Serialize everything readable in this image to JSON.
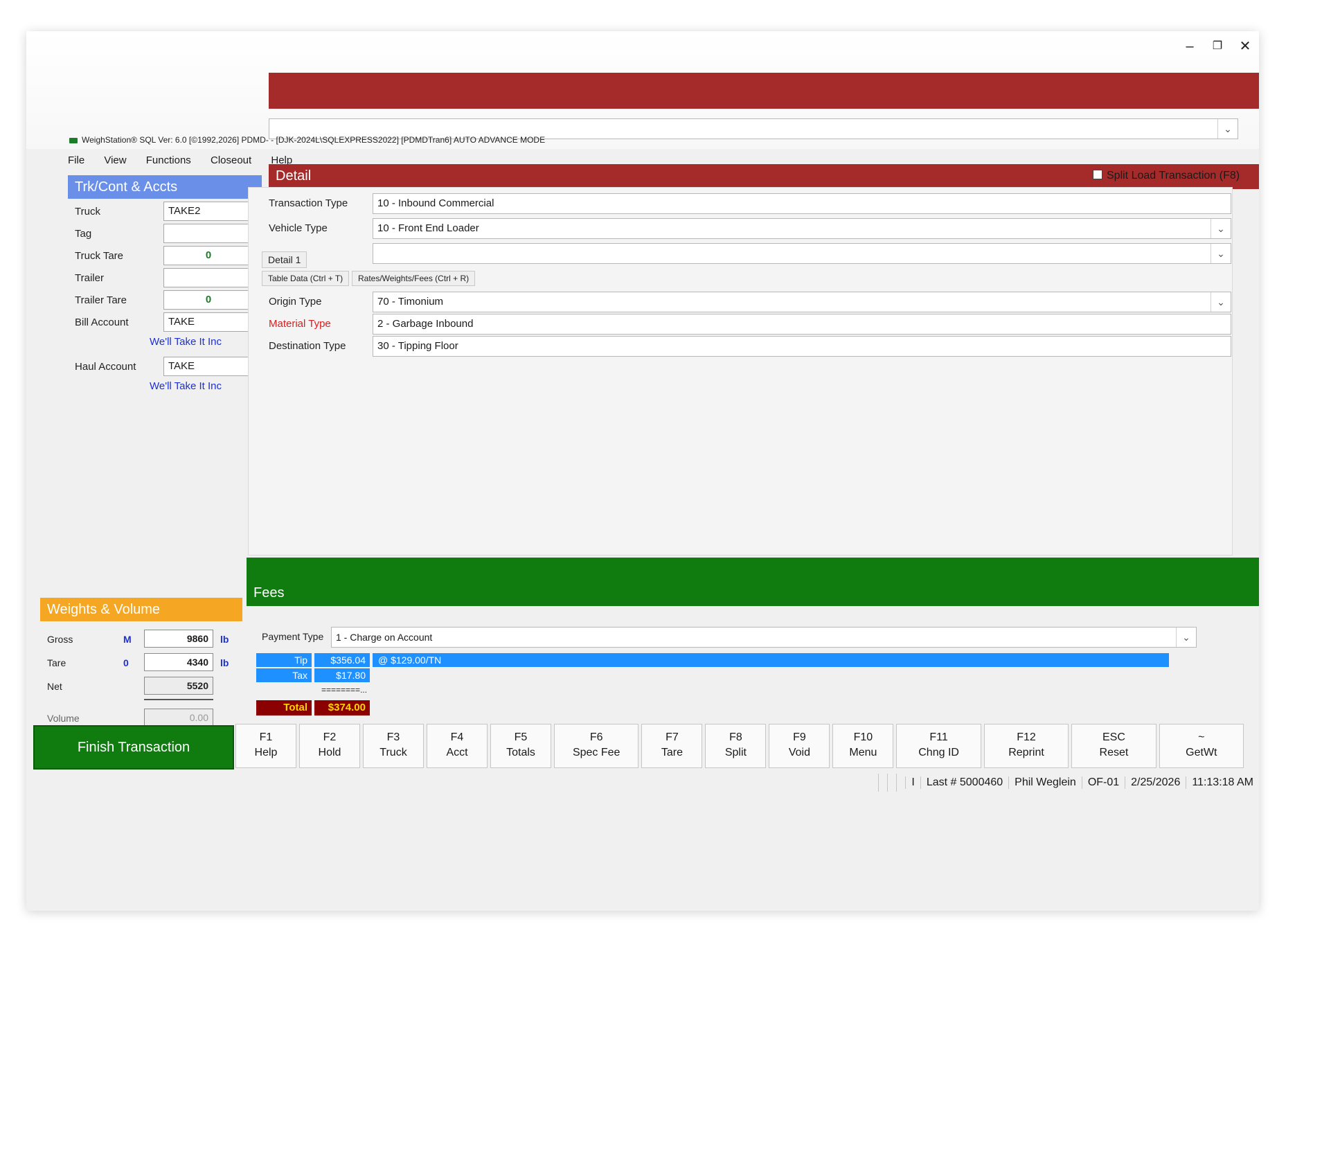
{
  "window": {
    "title": "WeighStation® SQL Ver: 6.0 [©1992,2026] PDMD- - [DJK-2024L\\SQLEXPRESS2022] [PDMDTran6] AUTO ADVANCE MODE",
    "controls": {
      "minimize": "–",
      "restore": "❐",
      "close": "✕"
    }
  },
  "menu": [
    "File",
    "View",
    "Functions",
    "Closeout",
    "Help"
  ],
  "left_panel": {
    "header": "Trk/Cont & Accts",
    "truck_label": "Truck",
    "truck_value": "TAKE2",
    "tag_label": "Tag",
    "tag_value": "",
    "truck_tare_label": "Truck Tare",
    "truck_tare_value": "0",
    "trailer_label": "Trailer",
    "trailer_value": "",
    "trailer_tare_label": "Trailer Tare",
    "trailer_tare_value": "0",
    "bill_account_label": "Bill Account",
    "bill_account_value": "TAKE",
    "bill_account_name": "We'll Take It Inc",
    "haul_account_label": "Haul Account",
    "haul_account_value": "TAKE",
    "haul_account_name": "We'll Take It Inc"
  },
  "detail": {
    "header": "Detail",
    "transaction_type_label": "Transaction Type",
    "transaction_type_value": "10 - Inbound Commercial",
    "vehicle_type_label": "Vehicle Type",
    "vehicle_type_value": "10 - Front End Loader",
    "split_load_label": "Split Load Transaction (F8)",
    "tabs": {
      "detail": "Detail 1",
      "table_data": "Table Data (Ctrl + T)",
      "rates": "Rates/Weights/Fees (Ctrl + R)"
    },
    "origin_type_label": "Origin Type",
    "origin_type_value": "70 - Timonium",
    "material_type_label": "Material Type",
    "material_type_value": "2 - Garbage Inbound",
    "destination_type_label": "Destination Type",
    "destination_type_value": "30 - Tipping Floor"
  },
  "weights": {
    "header": "Weights & Volume",
    "gross_label": "Gross",
    "gross_flag": "M",
    "gross_value": "9860",
    "gross_unit": "lb",
    "tare_label": "Tare",
    "tare_flag": "0",
    "tare_value": "4340",
    "tare_unit": "lb",
    "net_label": "Net",
    "net_value": "5520",
    "volume_label": "Volume",
    "volume_value": "0.00"
  },
  "fees": {
    "header": "Fees",
    "payment_type_label": "Payment Type",
    "payment_type_value": "1 - Charge on Account",
    "tip_label": "Tip",
    "tip_value": "$356.04",
    "tip_rate": "@ $129.00/TN",
    "tax_label": "Tax",
    "tax_value": "$17.80",
    "separator": "========...",
    "total_label": "Total",
    "total_value": "$374.00"
  },
  "actions": {
    "finish": "Finish Transaction",
    "keys": [
      {
        "key": "F1",
        "label": "Help"
      },
      {
        "key": "F2",
        "label": "Hold"
      },
      {
        "key": "F3",
        "label": "Truck"
      },
      {
        "key": "F4",
        "label": "Acct"
      },
      {
        "key": "F5",
        "label": "Totals"
      },
      {
        "key": "F6",
        "label": "Spec Fee"
      },
      {
        "key": "F7",
        "label": "Tare"
      },
      {
        "key": "F8",
        "label": "Split"
      },
      {
        "key": "F9",
        "label": "Void"
      },
      {
        "key": "F10",
        "label": "Menu"
      },
      {
        "key": "F11",
        "label": "Chng ID"
      },
      {
        "key": "F12",
        "label": "Reprint"
      },
      {
        "key": "ESC",
        "label": "Reset"
      },
      {
        "key": "~",
        "label": "GetWt"
      }
    ]
  },
  "status": {
    "mode": "I",
    "last": "Last # 5000460",
    "user": "Phil Weglein",
    "station": "OF-01",
    "date": "2/25/2026",
    "time": "11:13:18 AM"
  },
  "colors": {
    "detail_red": "#a52a2a",
    "accounts_blue": "#6a8fe8",
    "weights_orange": "#f5a623",
    "fees_green": "#107c10",
    "fee_blue": "#1e90ff",
    "total_maroon": "#8b0000"
  }
}
